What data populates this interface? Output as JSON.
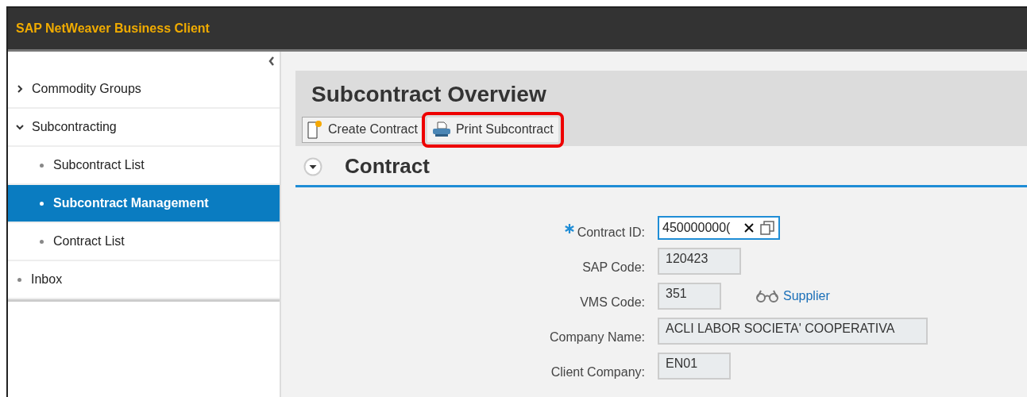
{
  "window": {
    "title": "SAP NetWeaver Business Client"
  },
  "sidebar": {
    "items": [
      {
        "label": "Commodity Groups",
        "kind": "folder",
        "expanded": false,
        "selected": false
      },
      {
        "label": "Subcontracting",
        "kind": "folder",
        "expanded": true,
        "selected": false,
        "children": [
          {
            "label": "Subcontract List",
            "kind": "leaf",
            "selected": false
          },
          {
            "label": "Subcontract Management",
            "kind": "leaf",
            "selected": true
          },
          {
            "label": "Contract List",
            "kind": "leaf",
            "selected": false
          }
        ]
      },
      {
        "label": "Inbox",
        "kind": "leaf",
        "selected": false
      }
    ]
  },
  "page": {
    "title": "Subcontract Overview",
    "toolbar": [
      {
        "label": "Create Contract",
        "kind": "create",
        "highlighted": false
      },
      {
        "label": "Print Subcontract",
        "kind": "print",
        "highlighted": true
      }
    ],
    "section": {
      "title": "Contract",
      "expanded": true
    },
    "fields": [
      {
        "label": "Contract ID:",
        "value": "450000000(",
        "required": true,
        "kind": "input"
      },
      {
        "label": "SAP Code:",
        "value": "120423",
        "required": false,
        "kind": "readonly"
      },
      {
        "label": "VMS Code:",
        "value": "351",
        "required": false,
        "kind": "readonly",
        "link": "Supplier"
      },
      {
        "label": "Company Name:",
        "value": "ACLI LABOR SOCIETA' COOPERATIVA",
        "required": false,
        "kind": "readonly"
      },
      {
        "label": "Client Company:",
        "value": "EN01",
        "required": false,
        "kind": "readonly"
      }
    ]
  }
}
